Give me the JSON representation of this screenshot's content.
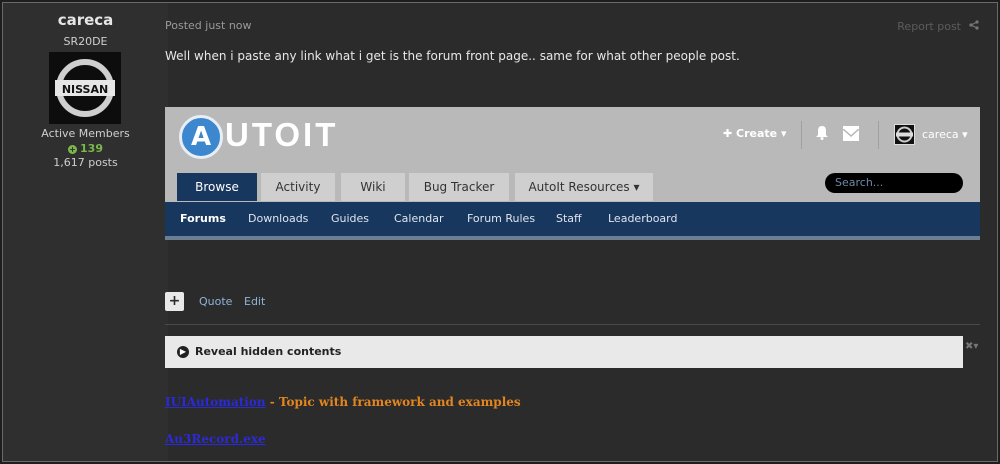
{
  "author": {
    "name": "careca",
    "title": "SR20DE",
    "avatar_text": "NISSAN",
    "group": "Active Members",
    "reputation": "139",
    "posts": "1,617 posts"
  },
  "post": {
    "meta": "Posted just now",
    "report": "Report post",
    "text": "Well when i paste any link what i get is the forum front page.. same for what other people post."
  },
  "embedded": {
    "logo_letter": "A",
    "logo_text": "UTOIT",
    "create": "Create",
    "user": "careca",
    "tabs": [
      {
        "label": "Browse"
      },
      {
        "label": "Activity"
      },
      {
        "label": "Wiki"
      },
      {
        "label": "Bug Tracker"
      },
      {
        "label": "AutoIt Resources"
      }
    ],
    "search_placeholder": "Search...",
    "nav": [
      {
        "label": "Forums"
      },
      {
        "label": "Downloads"
      },
      {
        "label": "Guides"
      },
      {
        "label": "Calendar"
      },
      {
        "label": "Forum Rules"
      },
      {
        "label": "Staff"
      },
      {
        "label": "Leaderboard"
      }
    ]
  },
  "actions": {
    "plus": "+",
    "quote": "Quote",
    "edit": "Edit"
  },
  "reveal": {
    "label": "Reveal hidden contents"
  },
  "signature": {
    "link1": "IUIAutomation",
    "desc1": " - Topic with framework and examples",
    "link2": "Au3Record.exe"
  },
  "colors": {
    "accent_navy": "#17375e",
    "link_blue": "#2a2ad6",
    "signature_orange": "#e3861f",
    "reputation_green": "#7bb84c"
  }
}
